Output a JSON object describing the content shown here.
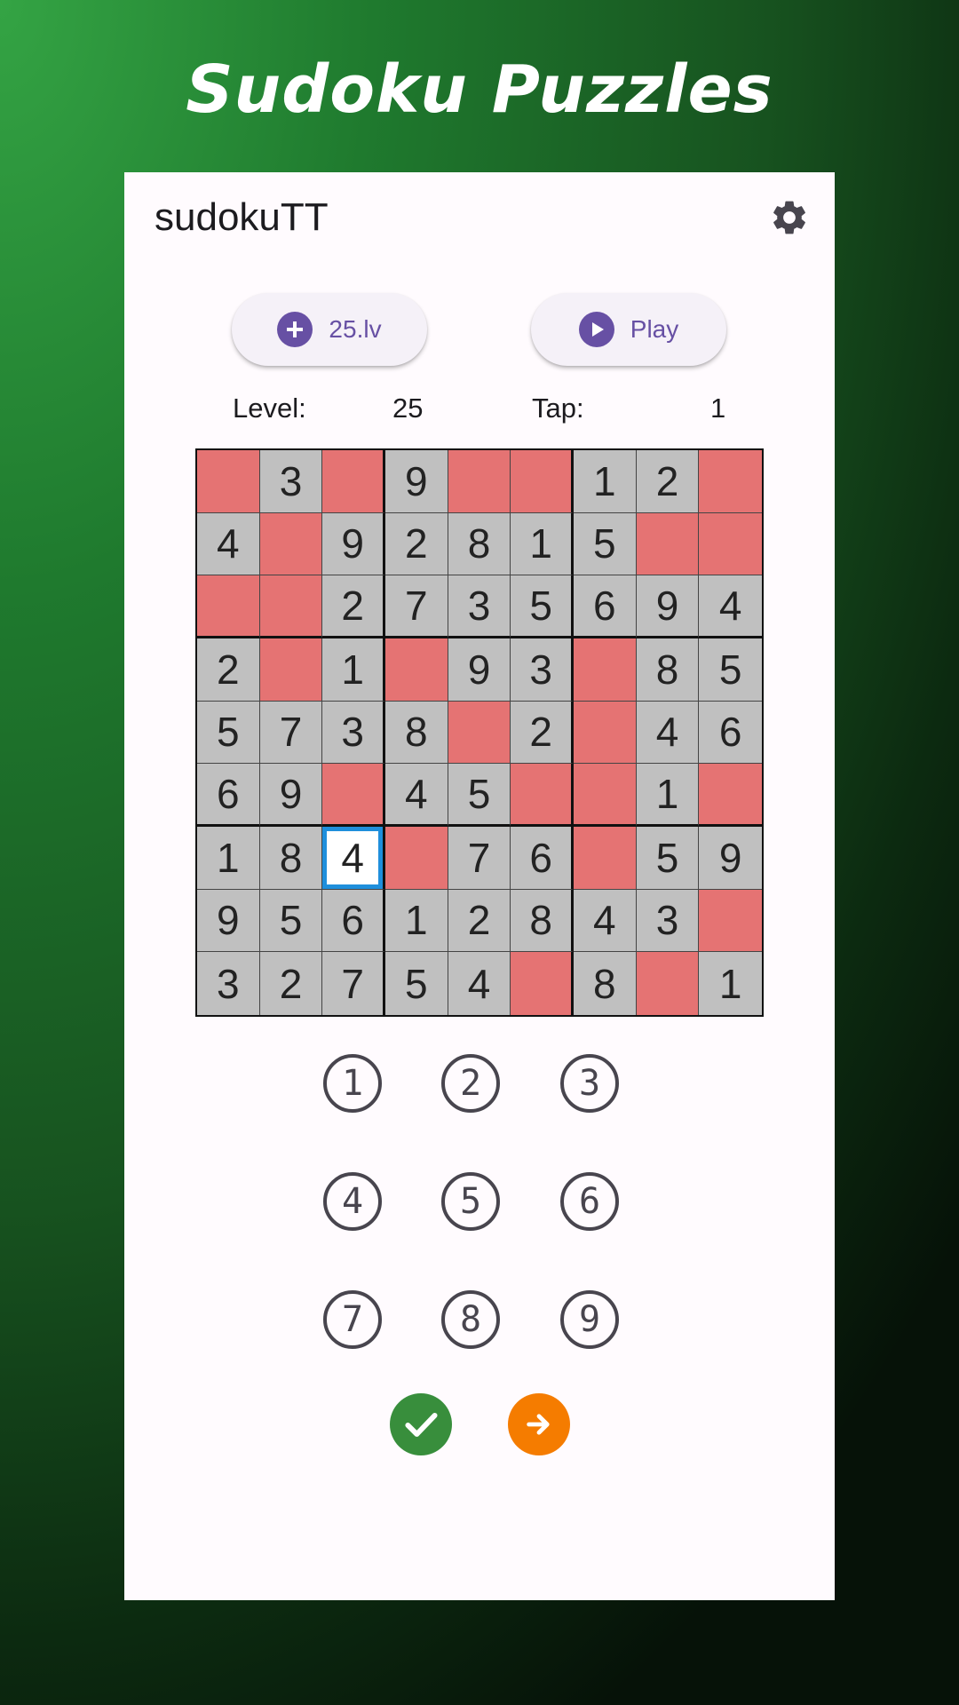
{
  "hero_title": "Sudoku Puzzles",
  "app": {
    "title": "sudokuTT",
    "settings_icon": "gear-icon"
  },
  "buttons": {
    "level_button_label": "25.lv",
    "level_button_icon": "plus-circle-icon",
    "play_button_label": "Play",
    "play_button_icon": "play-circle-icon"
  },
  "stats": {
    "level_label": "Level:",
    "level_value": "25",
    "tap_label": "Tap:",
    "tap_value": "1"
  },
  "board": {
    "rows": [
      [
        "",
        "3",
        "",
        "9",
        "",
        "",
        "1",
        "2",
        ""
      ],
      [
        "4",
        "",
        "9",
        "2",
        "8",
        "1",
        "5",
        "",
        ""
      ],
      [
        "",
        "",
        "2",
        "7",
        "3",
        "5",
        "6",
        "9",
        "4"
      ],
      [
        "2",
        "",
        "1",
        "",
        "9",
        "3",
        "",
        "8",
        "5"
      ],
      [
        "5",
        "7",
        "3",
        "8",
        "",
        "2",
        "",
        "4",
        "6"
      ],
      [
        "6",
        "9",
        "",
        "4",
        "5",
        "",
        "",
        "1",
        ""
      ],
      [
        "1",
        "8",
        "4",
        "",
        "7",
        "6",
        "",
        "5",
        "9"
      ],
      [
        "9",
        "5",
        "6",
        "1",
        "2",
        "8",
        "4",
        "3",
        ""
      ],
      [
        "3",
        "2",
        "7",
        "5",
        "4",
        "",
        "8",
        "",
        "1"
      ]
    ],
    "selected_cell": [
      6,
      2
    ],
    "empty_cell_color": "#e57373",
    "filled_cell_color": "#c0c0c0",
    "selected_border_color": "#1f8fdc"
  },
  "numpad": [
    "1",
    "2",
    "3",
    "4",
    "5",
    "6",
    "7",
    "8",
    "9"
  ],
  "actions": {
    "check_icon": "check-icon",
    "check_color": "#388e3c",
    "next_icon": "arrow-right-icon",
    "next_color": "#f57c00"
  },
  "colors": {
    "accent": "#6750a4",
    "card_background": "#fffbfe"
  }
}
